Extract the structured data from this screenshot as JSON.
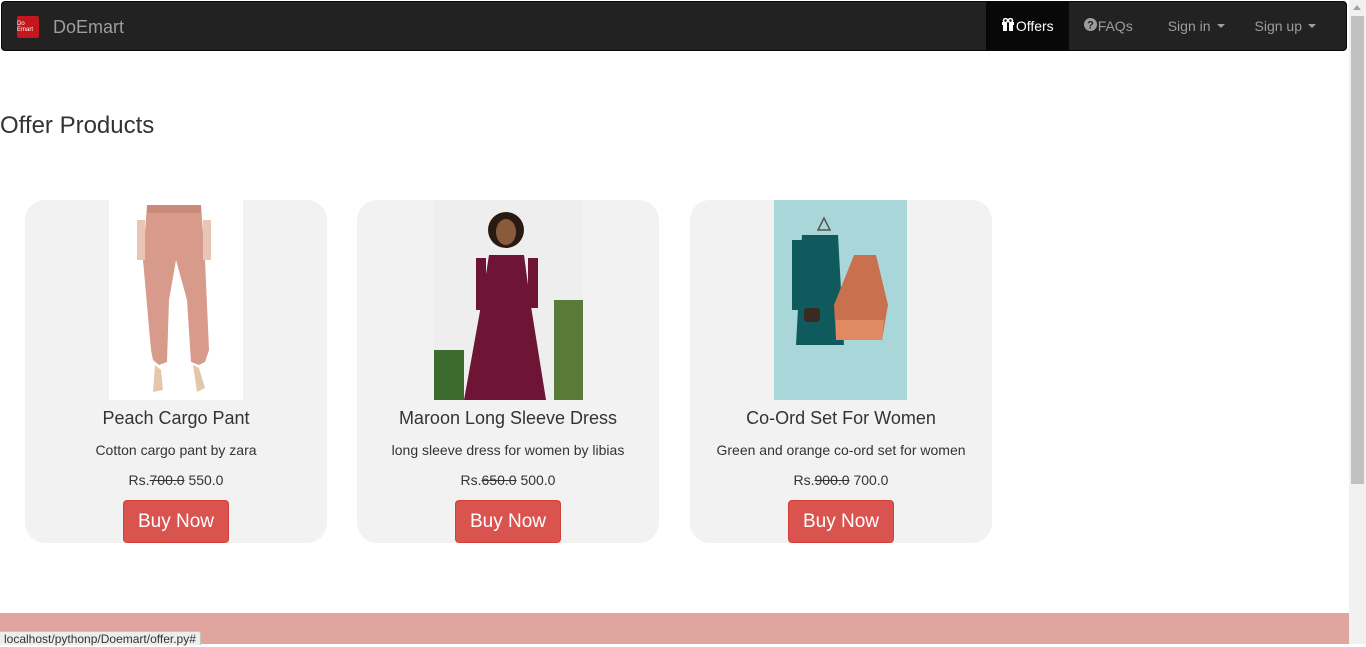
{
  "navbar": {
    "brand_logo_text": "Do Emart",
    "brand_name": "DoEmart",
    "items": [
      {
        "label": "Offers",
        "icon": "gift-icon"
      },
      {
        "label": "FAQs",
        "icon": "question-circle-icon"
      },
      {
        "label": "Sign in",
        "icon": "chevron-down-icon"
      },
      {
        "label": "Sign up",
        "icon": "chevron-down-icon"
      }
    ]
  },
  "page": {
    "title": "Offer Products"
  },
  "products": [
    {
      "name": "Peach Cargo Pant",
      "description": "Cotton cargo pant by zara",
      "currency": "Rs.",
      "old_price": "700.0",
      "price": "550.0",
      "button": "Buy Now"
    },
    {
      "name": "Maroon Long Sleeve Dress",
      "description": "long sleeve dress for women by libias",
      "currency": "Rs.",
      "old_price": "650.0",
      "price": "500.0",
      "button": "Buy Now"
    },
    {
      "name": "Co-Ord Set For Women",
      "description": "Green and orange co-ord set for women",
      "currency": "Rs.",
      "old_price": "900.0",
      "price": "700.0",
      "button": "Buy Now"
    }
  ],
  "status_bar": {
    "url": "localhost/pythonp/Doemart/offer.py#"
  },
  "colors": {
    "navbar": "#222222",
    "button": "#d9534f",
    "card": "#f2f2f2",
    "footer": "#e0a59f"
  }
}
